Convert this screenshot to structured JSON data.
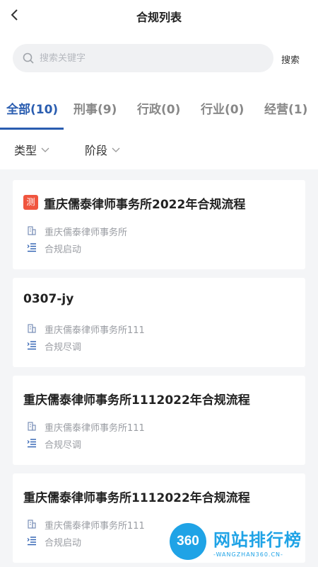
{
  "header": {
    "title": "合规列表",
    "back_icon": "chevron-left-icon"
  },
  "search": {
    "placeholder": "搜索关键字",
    "button_label": "搜索",
    "icon": "search-icon"
  },
  "tabs": [
    {
      "label": "全部(10)",
      "active": true
    },
    {
      "label": "刑事(9)",
      "active": false
    },
    {
      "label": "行政(0)",
      "active": false
    },
    {
      "label": "行业(0)",
      "active": false
    },
    {
      "label": "经营(1)",
      "active": false
    }
  ],
  "filters": [
    {
      "label": "类型",
      "icon": "chevron-down-icon"
    },
    {
      "label": "阶段",
      "icon": "chevron-down-icon"
    }
  ],
  "cards": [
    {
      "badge": "测",
      "title": "重庆儒泰律师事务所2022年合规流程",
      "org": "重庆儒泰律师事务所",
      "stage": "合规启动"
    },
    {
      "badge": "",
      "title": "0307-jy",
      "org": "重庆儒泰律师事务所111",
      "stage": "合规尽调"
    },
    {
      "badge": "",
      "title": "重庆儒泰律师事务所1112022年合规流程",
      "org": "重庆儒泰律师事务所111",
      "stage": "合规尽调"
    },
    {
      "badge": "",
      "title": "重庆儒泰律师事务所1112022年合规流程",
      "org": "重庆儒泰律师事务所111",
      "stage": "合规启动"
    }
  ],
  "watermark": {
    "logo": "360",
    "title": "网站排行榜",
    "subtitle": "-WANGZHAN360.CN-"
  },
  "colors": {
    "accent": "#2a5db0",
    "badge": "#f0553f",
    "background": "#f4f5f7",
    "watermark": "#1fa3e6"
  }
}
